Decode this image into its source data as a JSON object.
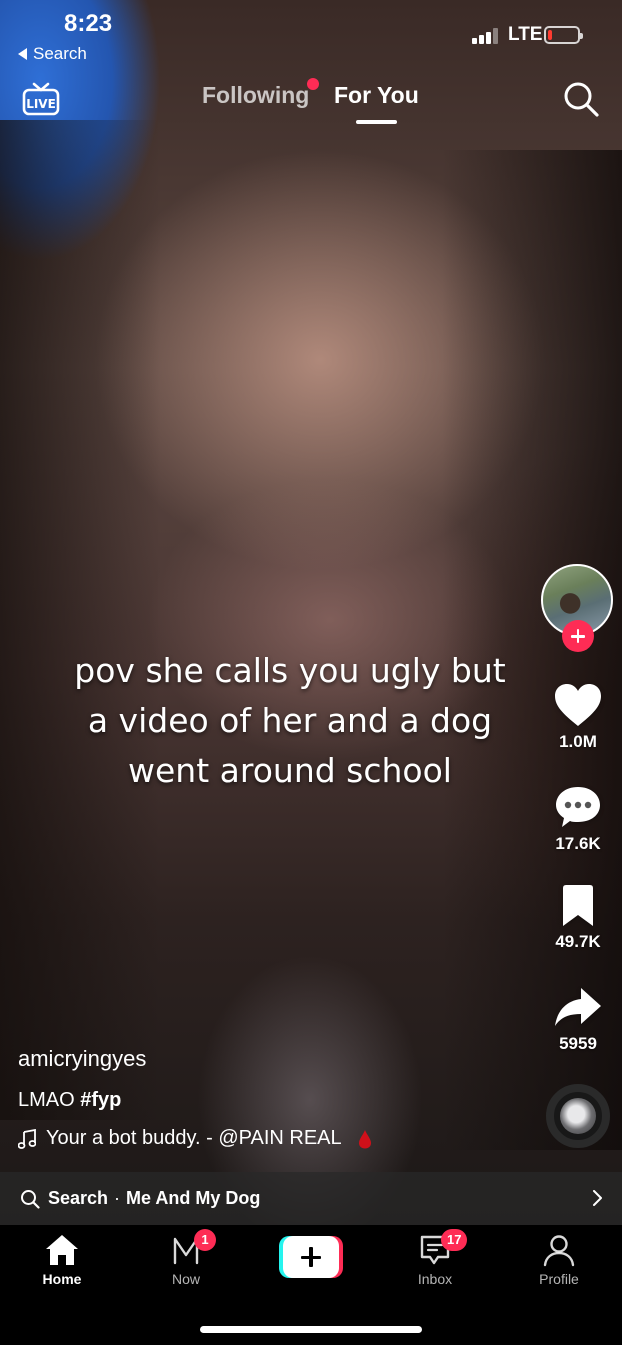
{
  "status_bar": {
    "time": "8:23",
    "back_label": "Search",
    "network": "LTE"
  },
  "top_nav": {
    "live_label": "LIVE",
    "tabs": [
      {
        "label": "Following",
        "has_dot": true
      },
      {
        "label": "For You",
        "active": true
      }
    ]
  },
  "video": {
    "caption_lines": [
      "pov she calls you ugly but",
      "a video of her and a dog",
      "went around school"
    ]
  },
  "actions": {
    "likes": "1.0M",
    "comments": "17.6K",
    "saves": "49.7K",
    "shares": "5959"
  },
  "post": {
    "author": "amicryingyes",
    "description_text": "LMAO ",
    "hashtag": "#fyp",
    "sound": "Your a bot buddy. - @PAIN REAL"
  },
  "search_bar": {
    "label": "Search",
    "separator": "·",
    "term": "Me And My Dog"
  },
  "tabbar": {
    "items": [
      {
        "label": "Home",
        "active": true
      },
      {
        "label": "Now",
        "badge": "1"
      },
      {
        "label": ""
      },
      {
        "label": "Inbox",
        "badge": "17"
      },
      {
        "label": "Profile"
      }
    ]
  },
  "colors": {
    "accent": "#fe2c55",
    "cyan": "#25f4ee"
  }
}
